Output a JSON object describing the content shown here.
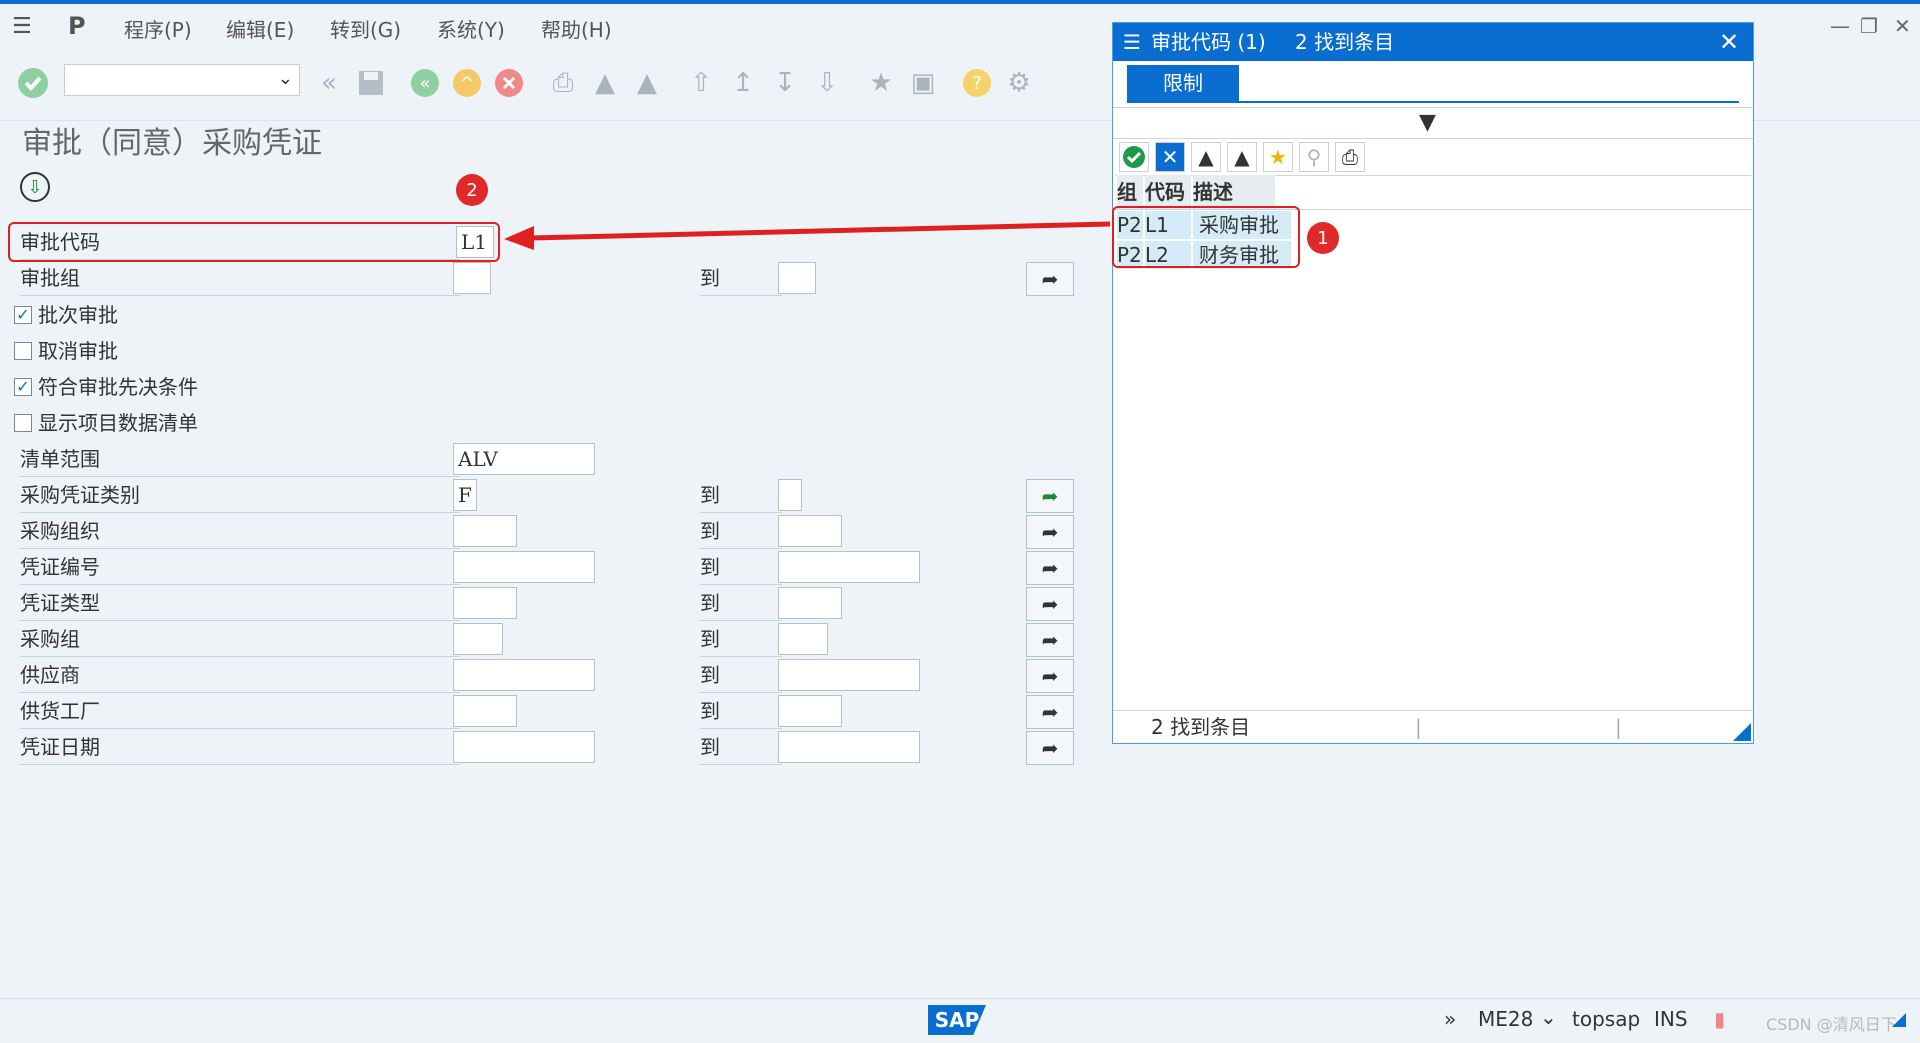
{
  "menu": {
    "items": [
      "程序(P)",
      "编辑(E)",
      "转到(G)",
      "系统(Y)",
      "帮助(H)"
    ]
  },
  "page": {
    "title": "审批（同意）采购凭证"
  },
  "form": {
    "to_label": "到",
    "fields": [
      {
        "label": "审批代码",
        "value": "L1"
      },
      {
        "label": "审批组",
        "value": ""
      },
      {
        "label": "清单范围",
        "value": "ALV"
      },
      {
        "label": "采购凭证类别",
        "value": "F"
      },
      {
        "label": "采购组织",
        "value": ""
      },
      {
        "label": "凭证编号",
        "value": ""
      },
      {
        "label": "凭证类型",
        "value": ""
      },
      {
        "label": "采购组",
        "value": ""
      },
      {
        "label": "供应商",
        "value": ""
      },
      {
        "label": "供货工厂",
        "value": ""
      },
      {
        "label": "凭证日期",
        "value": ""
      }
    ],
    "checkboxes": [
      {
        "label": "批次审批",
        "checked": true
      },
      {
        "label": "取消审批",
        "checked": false
      },
      {
        "label": "符合审批先决条件",
        "checked": true
      },
      {
        "label": "显示项目数据清单",
        "checked": false
      }
    ]
  },
  "popup": {
    "title": "审批代码 (1)",
    "subtitle": "2 找到条目",
    "tab": "限制",
    "columns": [
      "组",
      "代码",
      "描述"
    ],
    "rows": [
      {
        "group": "P2",
        "code": "L1",
        "desc": "采购审批"
      },
      {
        "group": "P2",
        "code": "L2",
        "desc": "财务审批"
      }
    ],
    "status": "2 找到条目"
  },
  "annotations": {
    "badge1": "1",
    "badge2": "2",
    "color": "#e02020"
  },
  "statusbar": {
    "logo": "SAP",
    "tcode": "ME28",
    "server": "topsap",
    "mode": "INS",
    "watermark": "CSDN @清风日下"
  },
  "colors": {
    "accent": "#0a6ed1",
    "background": "#eef3f8",
    "highlight": "#d4ecf7"
  }
}
